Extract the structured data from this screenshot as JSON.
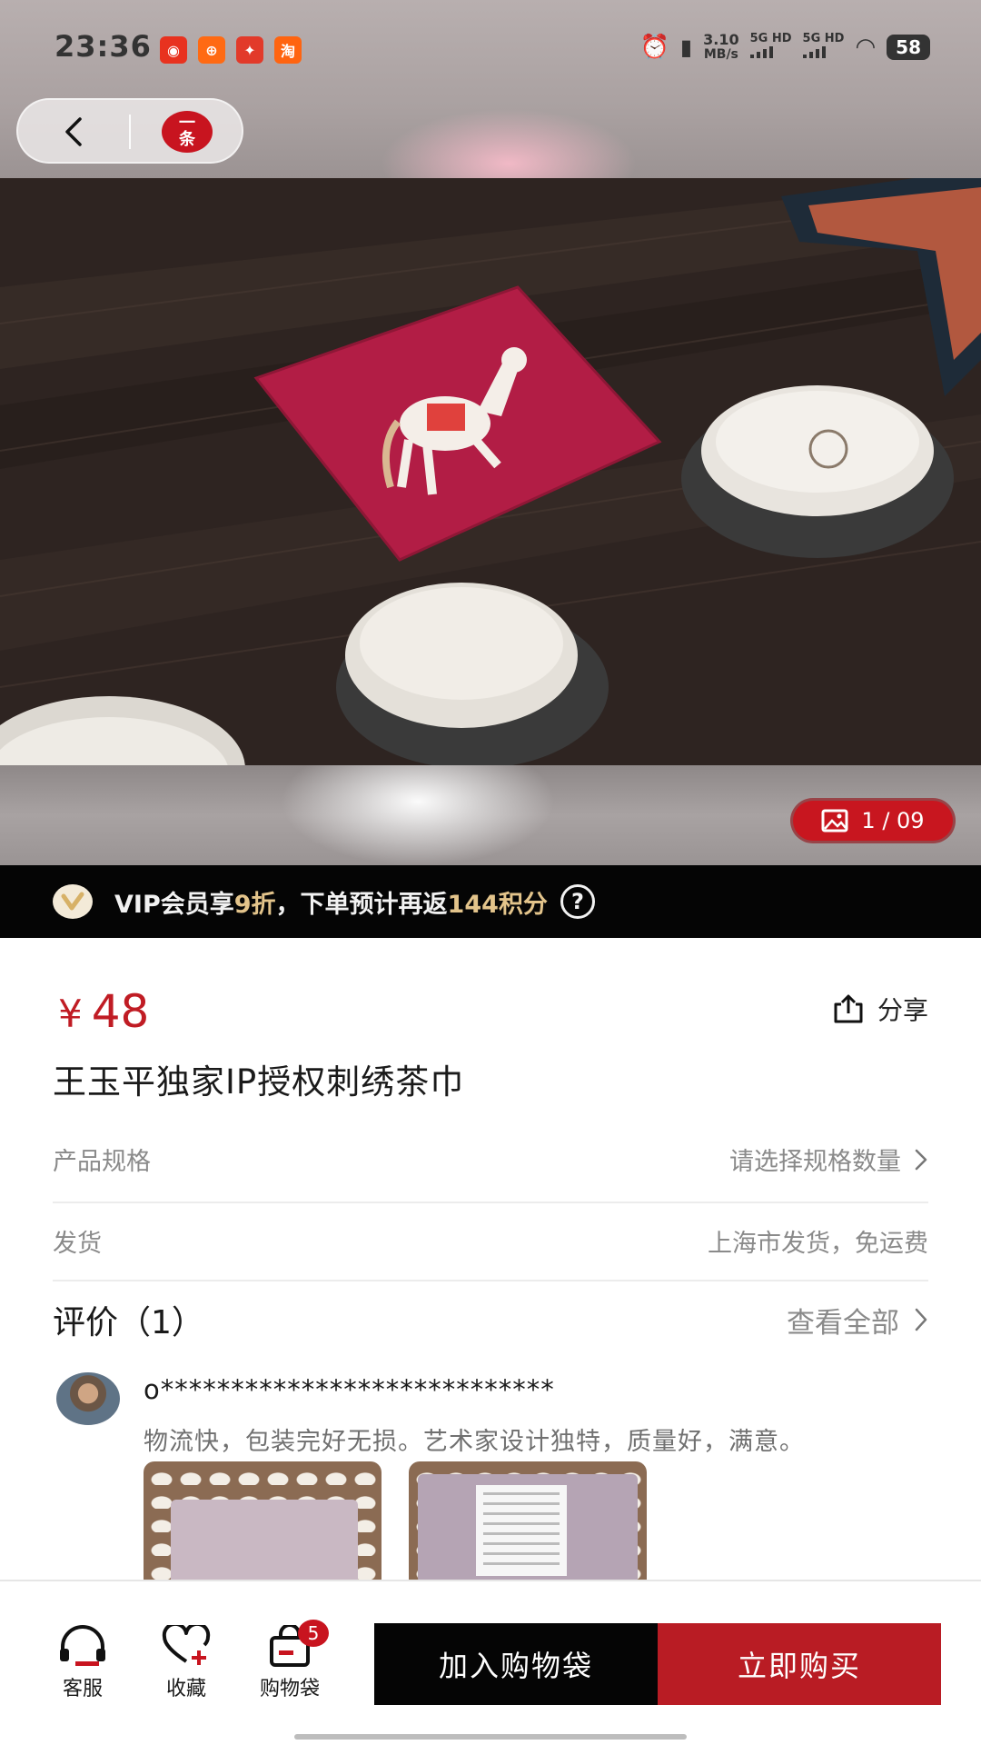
{
  "status_bar": {
    "time": "23:36",
    "net_speed_value": "3.10",
    "net_speed_unit": "MB/s",
    "signal1": "5G HD",
    "signal2": "5G HD",
    "battery": "58",
    "app_icons": [
      "netease-music-icon",
      "app-orange-icon",
      "app-red-icon",
      "taobao-icon"
    ]
  },
  "nav": {
    "logo_line1": "一",
    "logo_line2": "条"
  },
  "gallery": {
    "counter": "1 / 09"
  },
  "vip": {
    "text_prefix": "VIP会员享",
    "discount": "9折",
    "text_middle": "，下单预计再返",
    "points": "144积分",
    "help_symbol": "?"
  },
  "product": {
    "currency": "¥",
    "price": "48",
    "share_label": "分享",
    "title": "王玉平独家IP授权刺绣茶巾"
  },
  "spec_row": {
    "label": "产品规格",
    "value": "请选择规格数量"
  },
  "shipping_row": {
    "label": "发货",
    "value": "上海市发货，免运费"
  },
  "reviews": {
    "title": "评价（1）",
    "view_all": "查看全部",
    "items": [
      {
        "user": "o****************************",
        "text": "物流快，包装完好无损。艺术家设计独特，质量好，满意。"
      }
    ]
  },
  "bottom_bar": {
    "service_label": "客服",
    "favorite_label": "收藏",
    "cart_label": "购物袋",
    "cart_count": "5",
    "add_to_cart": "加入购物袋",
    "buy_now": "立即购买"
  },
  "colors": {
    "accent_red": "#c01c24",
    "vip_gold": "#e3c48b",
    "black": "#050505"
  }
}
